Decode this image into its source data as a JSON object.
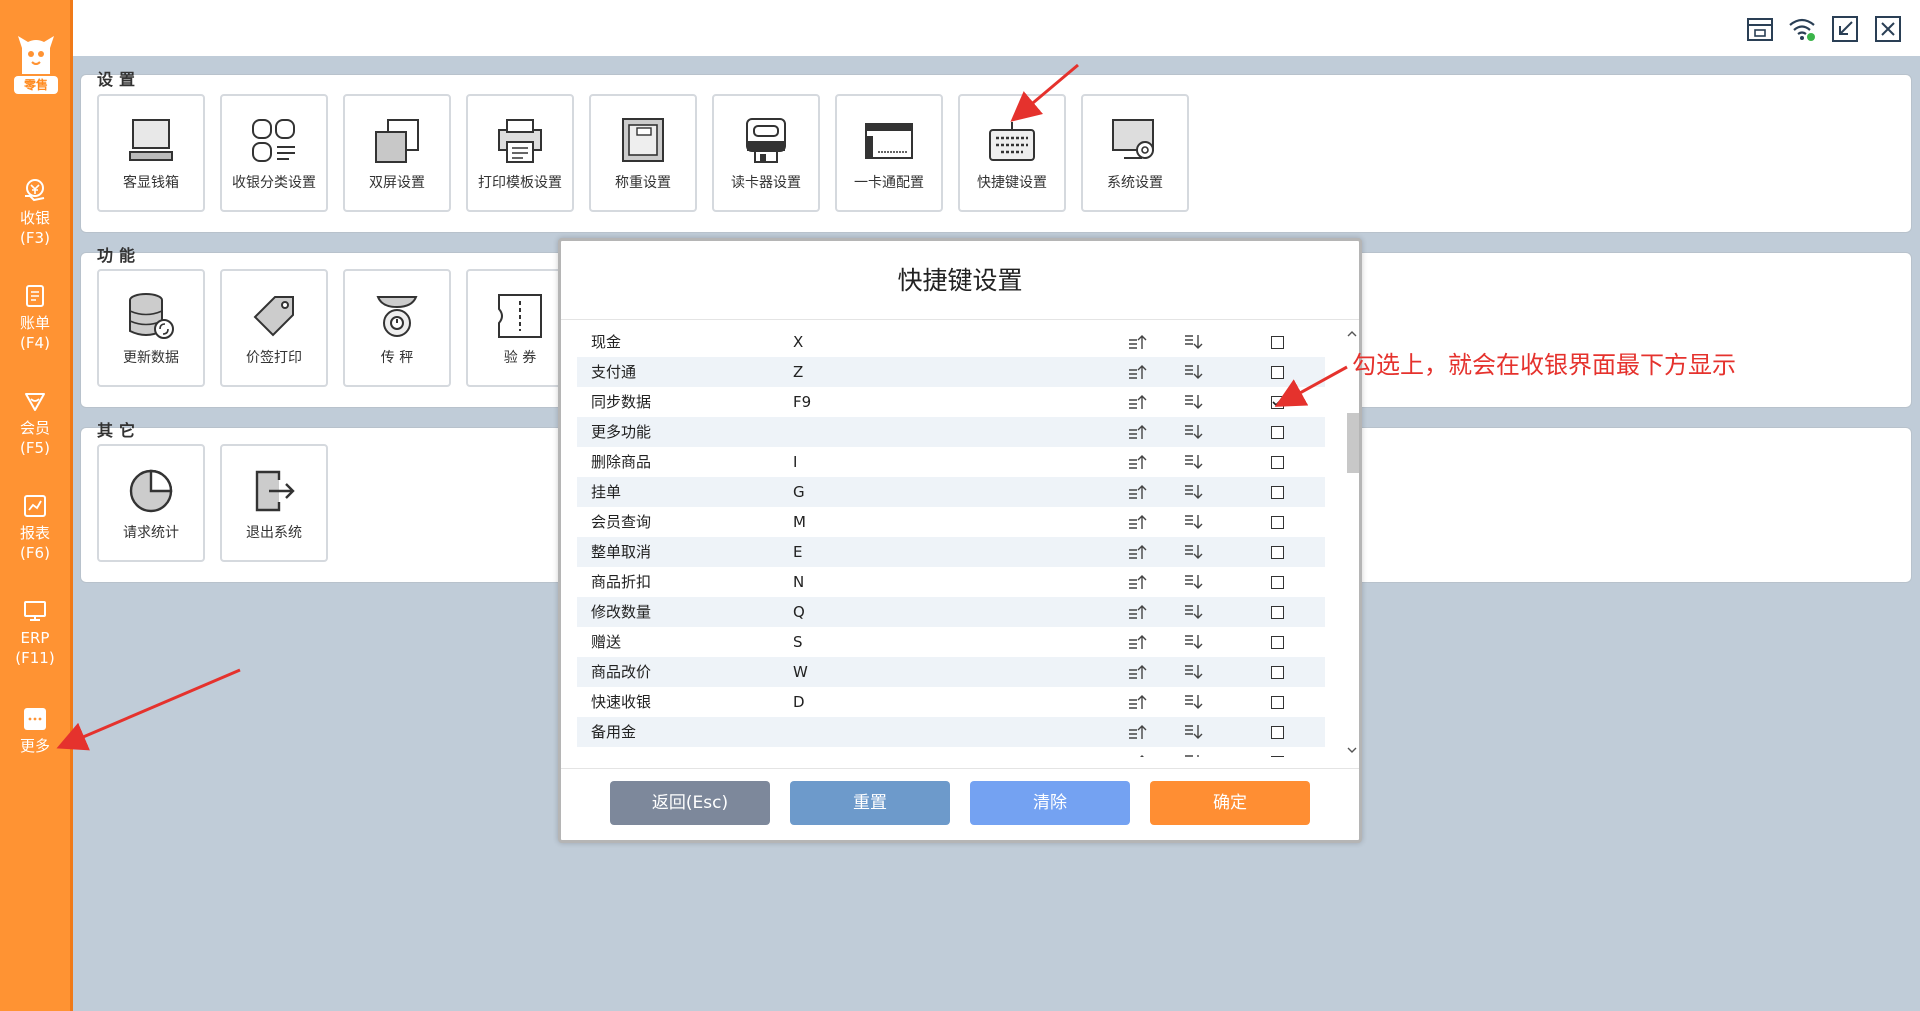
{
  "sidebar": {
    "logo_badge": "零售",
    "items": [
      {
        "label": "收银",
        "key": "(F3)",
        "icon": "cashier-icon"
      },
      {
        "label": "账单",
        "key": "(F4)",
        "icon": "bill-icon"
      },
      {
        "label": "会员",
        "key": "(F5)",
        "icon": "member-icon"
      },
      {
        "label": "报表",
        "key": "(F6)",
        "icon": "report-icon"
      },
      {
        "label": "ERP",
        "key": "(F11)",
        "icon": "erp-icon"
      },
      {
        "label": "更多",
        "key": "",
        "icon": "more-icon"
      }
    ]
  },
  "topbar": {
    "icons": [
      "store-icon",
      "wifi-icon",
      "minimize-icon",
      "close-icon"
    ]
  },
  "sections": {
    "settings": {
      "title": "设置",
      "tiles": [
        "客显钱箱",
        "收银分类设置",
        "双屏设置",
        "打印模板设置",
        "称重设置",
        "读卡器设置",
        "一卡通配置",
        "快捷键设置",
        "系统设置"
      ]
    },
    "functions": {
      "title": "功能",
      "tiles": [
        "更新数据",
        "价签打印",
        "传 秤",
        "验 券"
      ]
    },
    "others": {
      "title": "其它",
      "tiles": [
        "请求统计",
        "退出系统"
      ]
    }
  },
  "modal": {
    "title": "快捷键设置",
    "rows": [
      {
        "name": "现金",
        "key": "X",
        "checked": false
      },
      {
        "name": "支付通",
        "key": "Z",
        "checked": false
      },
      {
        "name": "同步数据",
        "key": "F9",
        "checked": true
      },
      {
        "name": "更多功能",
        "key": "",
        "checked": false
      },
      {
        "name": "删除商品",
        "key": "I",
        "checked": false
      },
      {
        "name": "挂单",
        "key": "G",
        "checked": false
      },
      {
        "name": "会员查询",
        "key": "M",
        "checked": false
      },
      {
        "name": "整单取消",
        "key": "E",
        "checked": false
      },
      {
        "name": "商品折扣",
        "key": "N",
        "checked": false
      },
      {
        "name": "修改数量",
        "key": "Q",
        "checked": false
      },
      {
        "name": "赠送",
        "key": "S",
        "checked": false
      },
      {
        "name": "商品改价",
        "key": "W",
        "checked": false
      },
      {
        "name": "快速收银",
        "key": "D",
        "checked": false
      },
      {
        "name": "备用金",
        "key": "",
        "checked": false
      },
      {
        "name": "",
        "key": "",
        "checked": false
      }
    ],
    "buttons": {
      "back": "返回(Esc)",
      "reset": "重置",
      "clear": "清除",
      "confirm": "确定"
    },
    "button_colors": {
      "back": "#7d889b",
      "reset": "#6d9acb",
      "clear": "#74a2f2",
      "confirm": "#ff8e33"
    }
  },
  "annotation": {
    "text": "勾选上，就会在收银界面最下方显示",
    "color": "#e5322d"
  }
}
